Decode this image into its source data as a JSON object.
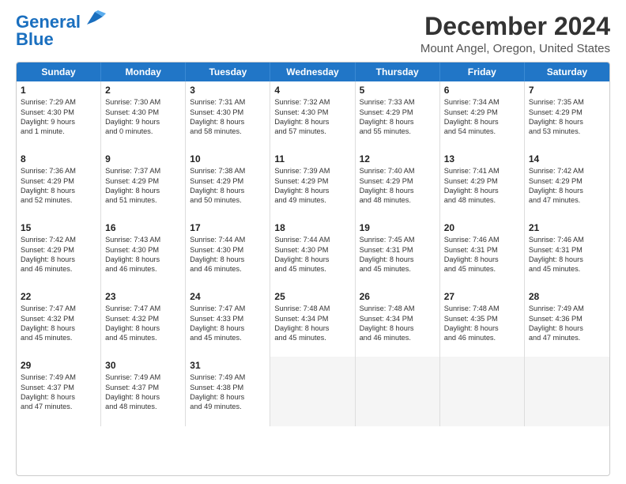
{
  "header": {
    "logo_line1": "General",
    "logo_line2": "Blue",
    "main_title": "December 2024",
    "subtitle": "Mount Angel, Oregon, United States"
  },
  "calendar": {
    "days_of_week": [
      "Sunday",
      "Monday",
      "Tuesday",
      "Wednesday",
      "Thursday",
      "Friday",
      "Saturday"
    ],
    "weeks": [
      [
        {
          "day": "1",
          "info": "Sunrise: 7:29 AM\nSunset: 4:30 PM\nDaylight: 9 hours\nand 1 minute."
        },
        {
          "day": "2",
          "info": "Sunrise: 7:30 AM\nSunset: 4:30 PM\nDaylight: 9 hours\nand 0 minutes."
        },
        {
          "day": "3",
          "info": "Sunrise: 7:31 AM\nSunset: 4:30 PM\nDaylight: 8 hours\nand 58 minutes."
        },
        {
          "day": "4",
          "info": "Sunrise: 7:32 AM\nSunset: 4:30 PM\nDaylight: 8 hours\nand 57 minutes."
        },
        {
          "day": "5",
          "info": "Sunrise: 7:33 AM\nSunset: 4:29 PM\nDaylight: 8 hours\nand 55 minutes."
        },
        {
          "day": "6",
          "info": "Sunrise: 7:34 AM\nSunset: 4:29 PM\nDaylight: 8 hours\nand 54 minutes."
        },
        {
          "day": "7",
          "info": "Sunrise: 7:35 AM\nSunset: 4:29 PM\nDaylight: 8 hours\nand 53 minutes."
        }
      ],
      [
        {
          "day": "8",
          "info": "Sunrise: 7:36 AM\nSunset: 4:29 PM\nDaylight: 8 hours\nand 52 minutes."
        },
        {
          "day": "9",
          "info": "Sunrise: 7:37 AM\nSunset: 4:29 PM\nDaylight: 8 hours\nand 51 minutes."
        },
        {
          "day": "10",
          "info": "Sunrise: 7:38 AM\nSunset: 4:29 PM\nDaylight: 8 hours\nand 50 minutes."
        },
        {
          "day": "11",
          "info": "Sunrise: 7:39 AM\nSunset: 4:29 PM\nDaylight: 8 hours\nand 49 minutes."
        },
        {
          "day": "12",
          "info": "Sunrise: 7:40 AM\nSunset: 4:29 PM\nDaylight: 8 hours\nand 48 minutes."
        },
        {
          "day": "13",
          "info": "Sunrise: 7:41 AM\nSunset: 4:29 PM\nDaylight: 8 hours\nand 48 minutes."
        },
        {
          "day": "14",
          "info": "Sunrise: 7:42 AM\nSunset: 4:29 PM\nDaylight: 8 hours\nand 47 minutes."
        }
      ],
      [
        {
          "day": "15",
          "info": "Sunrise: 7:42 AM\nSunset: 4:29 PM\nDaylight: 8 hours\nand 46 minutes."
        },
        {
          "day": "16",
          "info": "Sunrise: 7:43 AM\nSunset: 4:30 PM\nDaylight: 8 hours\nand 46 minutes."
        },
        {
          "day": "17",
          "info": "Sunrise: 7:44 AM\nSunset: 4:30 PM\nDaylight: 8 hours\nand 46 minutes."
        },
        {
          "day": "18",
          "info": "Sunrise: 7:44 AM\nSunset: 4:30 PM\nDaylight: 8 hours\nand 45 minutes."
        },
        {
          "day": "19",
          "info": "Sunrise: 7:45 AM\nSunset: 4:31 PM\nDaylight: 8 hours\nand 45 minutes."
        },
        {
          "day": "20",
          "info": "Sunrise: 7:46 AM\nSunset: 4:31 PM\nDaylight: 8 hours\nand 45 minutes."
        },
        {
          "day": "21",
          "info": "Sunrise: 7:46 AM\nSunset: 4:31 PM\nDaylight: 8 hours\nand 45 minutes."
        }
      ],
      [
        {
          "day": "22",
          "info": "Sunrise: 7:47 AM\nSunset: 4:32 PM\nDaylight: 8 hours\nand 45 minutes."
        },
        {
          "day": "23",
          "info": "Sunrise: 7:47 AM\nSunset: 4:32 PM\nDaylight: 8 hours\nand 45 minutes."
        },
        {
          "day": "24",
          "info": "Sunrise: 7:47 AM\nSunset: 4:33 PM\nDaylight: 8 hours\nand 45 minutes."
        },
        {
          "day": "25",
          "info": "Sunrise: 7:48 AM\nSunset: 4:34 PM\nDaylight: 8 hours\nand 45 minutes."
        },
        {
          "day": "26",
          "info": "Sunrise: 7:48 AM\nSunset: 4:34 PM\nDaylight: 8 hours\nand 46 minutes."
        },
        {
          "day": "27",
          "info": "Sunrise: 7:48 AM\nSunset: 4:35 PM\nDaylight: 8 hours\nand 46 minutes."
        },
        {
          "day": "28",
          "info": "Sunrise: 7:49 AM\nSunset: 4:36 PM\nDaylight: 8 hours\nand 47 minutes."
        }
      ],
      [
        {
          "day": "29",
          "info": "Sunrise: 7:49 AM\nSunset: 4:37 PM\nDaylight: 8 hours\nand 47 minutes."
        },
        {
          "day": "30",
          "info": "Sunrise: 7:49 AM\nSunset: 4:37 PM\nDaylight: 8 hours\nand 48 minutes."
        },
        {
          "day": "31",
          "info": "Sunrise: 7:49 AM\nSunset: 4:38 PM\nDaylight: 8 hours\nand 49 minutes."
        },
        {
          "day": "",
          "info": ""
        },
        {
          "day": "",
          "info": ""
        },
        {
          "day": "",
          "info": ""
        },
        {
          "day": "",
          "info": ""
        }
      ]
    ]
  }
}
